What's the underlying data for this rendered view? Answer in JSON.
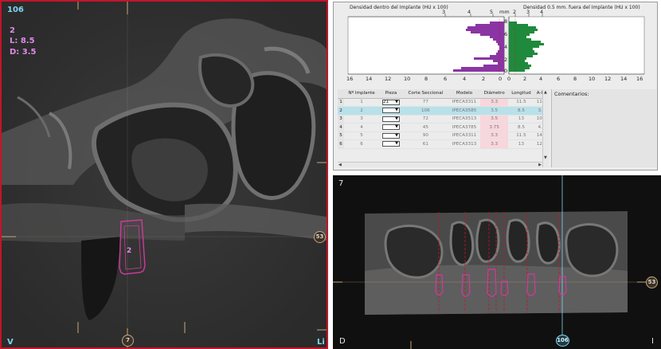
{
  "axial_view": {
    "slice_number": "106",
    "implant_number": "2",
    "length_label": "L: 8.5",
    "diameter_label": "D: 3.5",
    "implant_label": "2",
    "right_marker": "53",
    "bottom_marker": "7",
    "left_corner_label": "V",
    "right_corner_label": "Li"
  },
  "density_graph": {
    "inside_title": "Densidad dentro del Implante (HU x 100)",
    "outside_title": "Densidad 0.5 mm. fuera del Implante (HU x 100)",
    "depth_unit": "mm",
    "depth_ticks": [
      "8",
      "6",
      "4",
      "2",
      "0"
    ],
    "left_top_ticks": [
      "3",
      "4",
      "5"
    ],
    "right_top_ticks": [
      "2",
      "3",
      "4"
    ],
    "left_bottom_ticks": [
      "16",
      "14",
      "12",
      "10",
      "8",
      "6",
      "4",
      "2",
      "0"
    ],
    "right_bottom_ticks": [
      "0",
      "2",
      "4",
      "6",
      "8",
      "10",
      "12",
      "14",
      "16"
    ],
    "inside_color": "#8a35a3",
    "outside_color": "#1f8a3c"
  },
  "implant_table": {
    "headers": [
      "Nº Implante",
      "Pieza",
      "Corte Seccional",
      "Modelo",
      "Diámetro",
      "Longitud",
      "A-I-L"
    ],
    "rows": [
      {
        "row": "1",
        "implant": "1",
        "pieza": "21",
        "corte": "77",
        "modelo": "IPECA3311",
        "diametro": "3.3",
        "longitud": "11.5",
        "ail": "11.0"
      },
      {
        "row": "2",
        "implant": "2",
        "pieza": "",
        "corte": "106",
        "modelo": "IPECA3585",
        "diametro": "3.5",
        "longitud": "8.5",
        "ail": "3.6"
      },
      {
        "row": "3",
        "implant": "3",
        "pieza": "",
        "corte": "72",
        "modelo": "IPECA3513",
        "diametro": "3.5",
        "longitud": "13",
        "ail": "10.1"
      },
      {
        "row": "4",
        "implant": "4",
        "pieza": "",
        "corte": "45",
        "modelo": "IPECA3785",
        "diametro": "3.75",
        "longitud": "8.5",
        "ail": "4.6"
      },
      {
        "row": "5",
        "implant": "5",
        "pieza": "",
        "corte": "90",
        "modelo": "IPECA3311",
        "diametro": "3.3",
        "longitud": "11.5",
        "ail": "14.7"
      },
      {
        "row": "6",
        "implant": "6",
        "pieza": "",
        "corte": "61",
        "modelo": "IPECA3313",
        "diametro": "3.3",
        "longitud": "13",
        "ail": "12.3"
      }
    ],
    "selected_row": 2
  },
  "comments": {
    "label": "Comentarios:"
  },
  "panoramic_view": {
    "slice_number": "7",
    "right_marker": "53",
    "bottom_marker": "106",
    "left_corner_label": "D",
    "right_corner_label": "I"
  },
  "colors": {
    "accent_border": "#c4142a",
    "implant_outline": "#d13a9a",
    "cyan_overlay": "#7fd6ef",
    "pink_overlay": "#e08ae8",
    "selected_row": "#b8e1ea",
    "pink_cell": "#f8d6dc"
  }
}
